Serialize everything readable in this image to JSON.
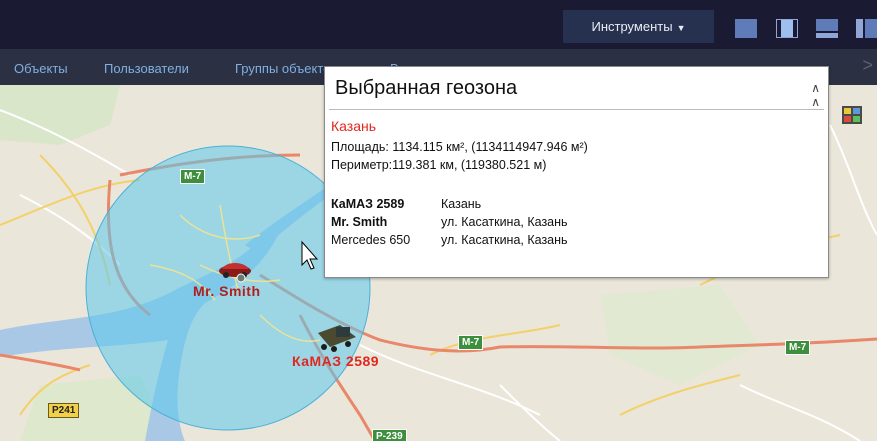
{
  "header": {
    "tools_label": "Инструменты",
    "layout_buttons": [
      "layout-single",
      "layout-split-vertical",
      "layout-split-horizontal",
      "layout-grid"
    ]
  },
  "nav": {
    "items": [
      {
        "label": "Объекты"
      },
      {
        "label": "Пользователи"
      },
      {
        "label": "Группы объектов"
      },
      {
        "label": "Водители"
      }
    ]
  },
  "map": {
    "roads": [
      "M-7",
      "M-7",
      "M-7",
      "P241",
      "P-239"
    ],
    "markers": [
      {
        "label": "Mr. Smith",
        "color": "#b02020"
      },
      {
        "label": "КаМАЗ 2589",
        "color": "#e0281e"
      }
    ],
    "geozone_color": "#5bc8ec"
  },
  "popup": {
    "title": "Выбранная геозона",
    "zone_name": "Казань",
    "area": "Площадь: 1134.115 км², (1134114947.946 м²)",
    "perimeter": "Периметр:119.381 км, (119380.521 м)",
    "objects": [
      {
        "name": "КаМАЗ 2589",
        "address": "Казань",
        "bold": true
      },
      {
        "name": "Mr. Smith",
        "address": "ул. Касаткина, Казань",
        "bold": true
      },
      {
        "name": "Mercedes 650",
        "address": "ул. Касаткина, Казань",
        "bold": false
      }
    ]
  }
}
